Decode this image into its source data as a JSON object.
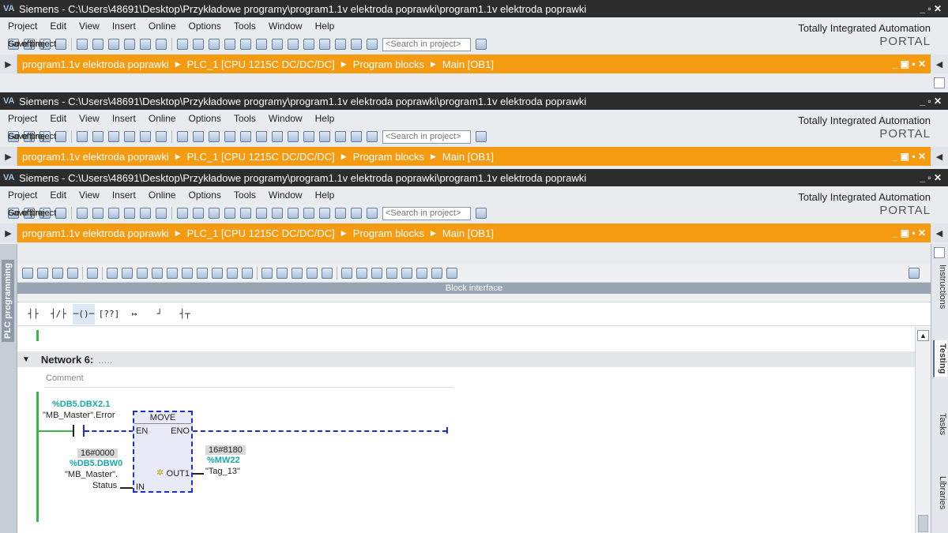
{
  "windows": [
    {
      "title": "Siemens  -  C:\\Users\\48691\\Desktop\\Przykładowe programy\\program1.1v elektroda poprawki\\program1.1v elektroda poprawki"
    },
    {
      "title": "Siemens  -  C:\\Users\\48691\\Desktop\\Przykładowe programy\\program1.1v elektroda poprawki\\program1.1v elektroda poprawki"
    },
    {
      "title": "Siemens  -  C:\\Users\\48691\\Desktop\\Przykładowe programy\\program1.1v elektroda poprawki\\program1.1v elektroda poprawki"
    }
  ],
  "app_logo": "VA",
  "menu": [
    "Project",
    "Edit",
    "View",
    "Insert",
    "Online",
    "Options",
    "Tools",
    "Window",
    "Help"
  ],
  "toolbar": {
    "save_label": "Save project",
    "go_online": "Go online",
    "go_offline": "Go offline",
    "search_placeholder": "<Search in project>"
  },
  "tia": {
    "line1": "Totally Integrated Automation",
    "line2": "PORTAL"
  },
  "breadcrumb": [
    "program1.1v elektroda poprawki",
    "PLC_1 [CPU 1215C DC/DC/DC]",
    "Program blocks",
    "Main [OB1]"
  ],
  "left_tab": "PLC programming",
  "right_tabs": [
    "Instructions",
    "Testing",
    "Tasks",
    "Libraries"
  ],
  "block_interface": "Block interface",
  "network": {
    "label": "Network 6:",
    "dots": ".....",
    "comment_placeholder": "Comment",
    "contact_addr": "%DB5.DBX2.1",
    "contact_name": "\"MB_Master\".Error",
    "move_title": "MOVE",
    "pin_en": "EN",
    "pin_eno": "ENO",
    "pin_in": "IN",
    "pin_out": "OUT1",
    "in_value": "16#0000",
    "in_addr": "%DB5.DBW0",
    "in_name1": "\"MB_Master\".",
    "in_name2": "Status",
    "out_value": "16#8180",
    "out_addr": "%MW22",
    "out_name": "\"Tag_13\""
  },
  "colors": {
    "orange": "#f49b11",
    "teal": "#19a7a6",
    "rail": "#3cb54a",
    "wire": "#1f2fcf"
  }
}
